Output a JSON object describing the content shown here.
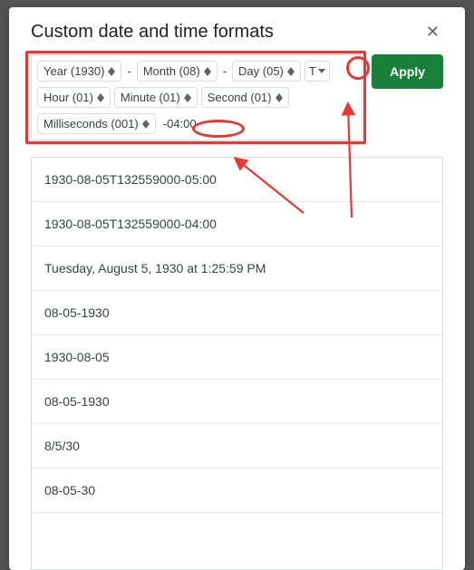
{
  "dialog": {
    "title": "Custom date and time formats",
    "apply_label": "Apply"
  },
  "tokens": {
    "year": "Year (1930)",
    "month": "Month (08)",
    "day": "Day (05)",
    "t": "T",
    "hour": "Hour (01)",
    "minute": "Minute (01)",
    "second": "Second (01)",
    "ms": "Milliseconds (001)",
    "tz": "-04:00",
    "dash": "-"
  },
  "options": [
    "1930-08-05T132559000-05:00",
    "1930-08-05T132559000-04:00",
    "Tuesday, August 5, 1930 at 1:25:59 PM",
    "08-05-1930",
    "1930-08-05",
    "08-05-1930",
    "8/5/30",
    "08-05-30"
  ]
}
